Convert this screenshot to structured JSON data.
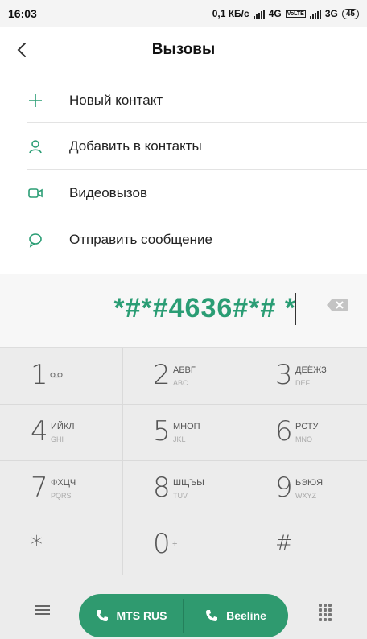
{
  "status": {
    "time": "16:03",
    "speed": "0,1 КБ/с",
    "net1": "4G",
    "volte": "VoLTE",
    "net2": "3G",
    "battery": "45"
  },
  "header": {
    "title": "Вызовы",
    "back_icon": "chevron-left-icon"
  },
  "menu": {
    "items": [
      {
        "label": "Новый контакт",
        "icon": "plus-icon"
      },
      {
        "label": "Добавить в контакты",
        "icon": "person-icon"
      },
      {
        "label": "Видеовызов",
        "icon": "video-icon"
      },
      {
        "label": "Отправить сообщение",
        "icon": "message-icon"
      }
    ]
  },
  "dialer": {
    "number": "*#*#4636#*# *"
  },
  "keypad": {
    "keys": [
      {
        "digit": "1",
        "letters": "",
        "latin": "",
        "icon": "voicemail-icon"
      },
      {
        "digit": "2",
        "letters": "АБВГ",
        "latin": "ABC"
      },
      {
        "digit": "3",
        "letters": "ДЕЁЖЗ",
        "latin": "DEF"
      },
      {
        "digit": "4",
        "letters": "ИЙКЛ",
        "latin": "GHI"
      },
      {
        "digit": "5",
        "letters": "МНОП",
        "latin": "JKL"
      },
      {
        "digit": "6",
        "letters": "РСТУ",
        "latin": "MNO"
      },
      {
        "digit": "7",
        "letters": "ФХЦЧ",
        "latin": "PQRS"
      },
      {
        "digit": "8",
        "letters": "ШЩЪЫ",
        "latin": "TUV"
      },
      {
        "digit": "9",
        "letters": "ЬЭЮЯ",
        "latin": "WXYZ"
      },
      {
        "digit": "*",
        "letters": "",
        "latin": ""
      },
      {
        "digit": "0",
        "letters": "+",
        "latin": ""
      },
      {
        "digit": "#",
        "letters": "",
        "latin": ""
      }
    ]
  },
  "bottom": {
    "sim1_label": "MTS RUS",
    "sim2_label": "Beeline",
    "accent_color": "#2f9a6f"
  }
}
